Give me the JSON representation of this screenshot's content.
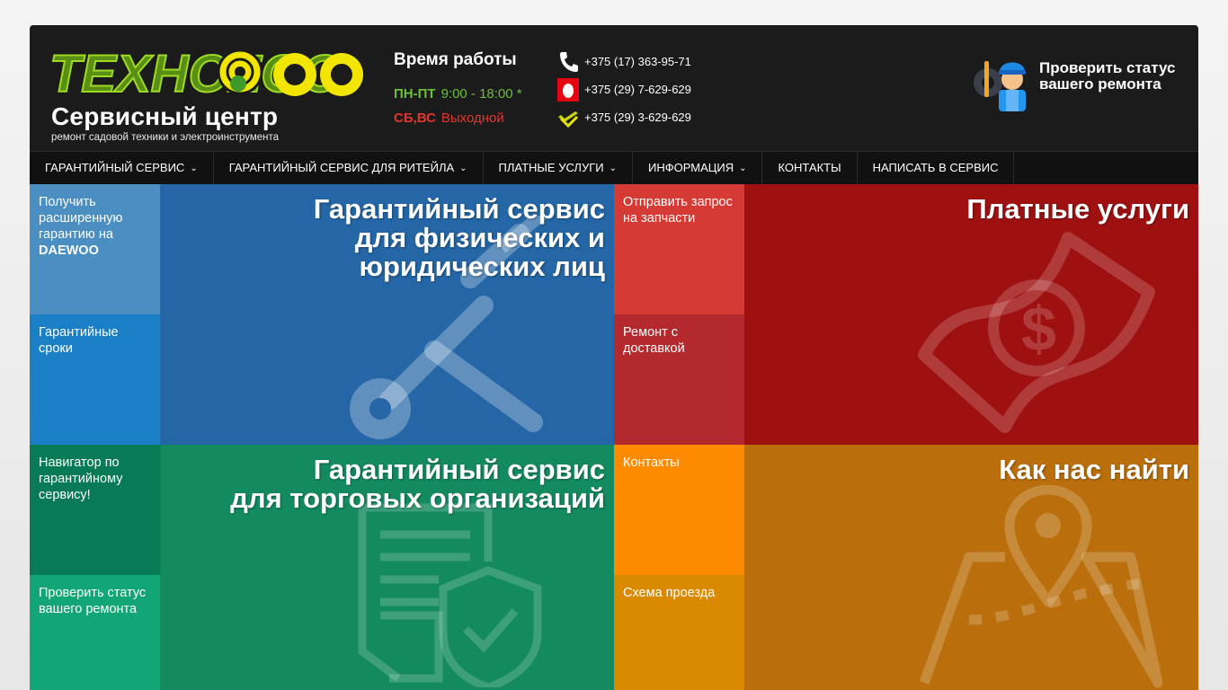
{
  "header": {
    "logo": {
      "brand": "TEXHOZOO",
      "title": "Сервисный центр",
      "subtitle": "ремонт садовой техники и электроинструмента"
    },
    "hours": {
      "title": "Время работы",
      "weekdays": {
        "days": "ПН-ПТ",
        "time": "9:00 - 18:00 *"
      },
      "weekend": {
        "days": "СБ,ВС",
        "time": "Выходной"
      }
    },
    "phones": [
      {
        "icon": "phone-icon",
        "number": "+375 (17) 363-95-71"
      },
      {
        "icon": "mts-icon",
        "number": "+375 (29) 7-629-629"
      },
      {
        "icon": "velcom-icon",
        "number": "+375 (29) 3-629-629"
      }
    ],
    "status_link": {
      "icon": "repairman-icon",
      "line1": "Проверить статус",
      "line2": "вашего ремонта"
    }
  },
  "nav": {
    "items": [
      {
        "label": "ГАРАНТИЙНЫЙ СЕРВИС",
        "has_dropdown": true
      },
      {
        "label": "ГАРАНТИЙНЫЙ СЕРВИС ДЛЯ РИТЕЙЛА",
        "has_dropdown": true
      },
      {
        "label": "ПЛАТНЫЕ УСЛУГИ",
        "has_dropdown": true
      },
      {
        "label": "ИНФОРМАЦИЯ",
        "has_dropdown": true
      },
      {
        "label": "КОНТАКТЫ",
        "has_dropdown": false
      },
      {
        "label": "НАПИСАТЬ В СЕРВИС",
        "has_dropdown": false
      }
    ],
    "chevron": "⌄"
  },
  "tiles": {
    "extended_warranty": {
      "text": "Получить расширенную гарантию на",
      "brand": "DAEWOO",
      "color": "#4a8ec2"
    },
    "warranty_terms": {
      "text": "Гарантийные сроки",
      "color": "#1a7fc4"
    },
    "warranty_private": {
      "line1": "Гарантийный сервис",
      "line2": "для физических и",
      "line3": "юридических лиц",
      "icon": "tools-icon",
      "color": "#2466a6"
    },
    "send_parts_request": {
      "text": "Отправить запрос на запчасти",
      "color": "#d63a34"
    },
    "repair_delivery": {
      "text": "Ремонт с доставкой",
      "color": "#b3292d"
    },
    "paid_services": {
      "text": "Платные услуги",
      "icon": "money-icon",
      "color": "#9f1111"
    },
    "warranty_navigator": {
      "text": "Навигатор по гарантийному сервису!",
      "color": "#087a55"
    },
    "check_status": {
      "text": "Проверить статус вашего ремонта",
      "color": "#12a575"
    },
    "warranty_retail": {
      "line1": "Гарантийный сервис",
      "line2": "для торговых организаций",
      "icon": "document-shield-icon",
      "color": "#148a60"
    },
    "contacts": {
      "text": "Контакты",
      "color": "#fe8a00"
    },
    "route_map": {
      "text": "Схема проезда",
      "color": "#d98a00"
    },
    "find_us": {
      "text": "Как нас найти",
      "icon": "map-pin-icon",
      "color": "#ba6f0c"
    }
  }
}
